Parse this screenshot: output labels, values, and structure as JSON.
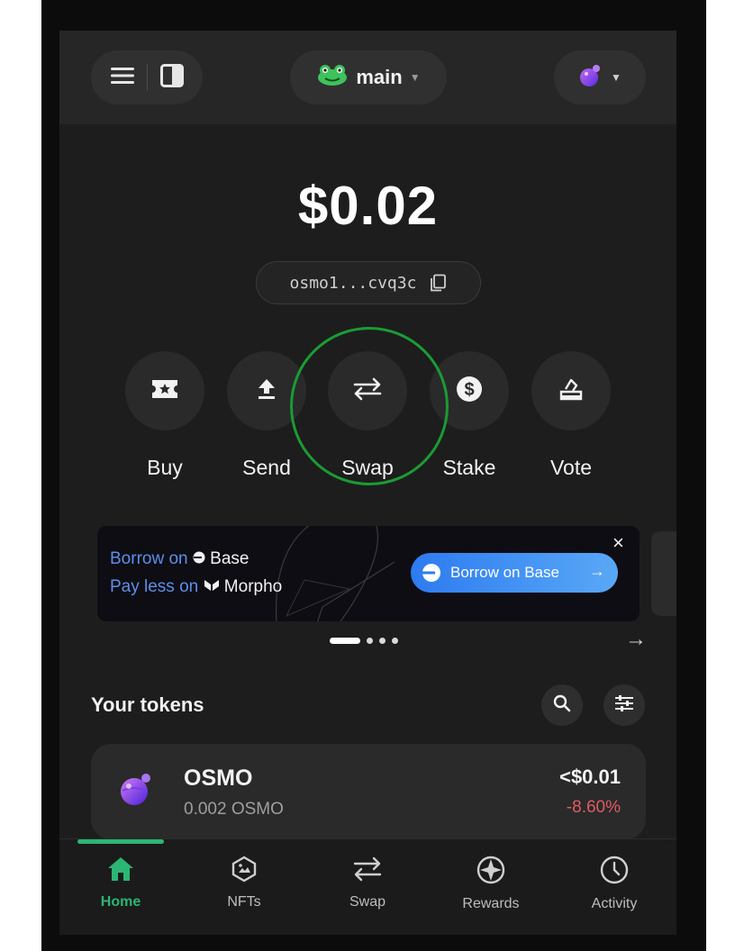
{
  "header": {
    "wallet_name": "main"
  },
  "balance": "$0.02",
  "address": "osmo1...cvq3c",
  "actions": [
    {
      "label": "Buy",
      "icon": "ticket-icon"
    },
    {
      "label": "Send",
      "icon": "upload-icon"
    },
    {
      "label": "Swap",
      "icon": "swap-arrows-icon"
    },
    {
      "label": "Stake",
      "icon": "dollar-coin-icon"
    },
    {
      "label": "Vote",
      "icon": "ballot-icon"
    }
  ],
  "banner": {
    "line1_prefix": "Borrow on",
    "line1_brand": "Base",
    "line2_prefix": "Pay less on",
    "line2_brand": "Morpho",
    "button_label": "Borrow on Base",
    "close": "×"
  },
  "carousel": {
    "next_arrow": "→"
  },
  "tokens_section": {
    "title": "Your tokens"
  },
  "tokens": [
    {
      "symbol": "OSMO",
      "amount": "0.002 OSMO",
      "value": "<$0.01",
      "change": "-8.60%"
    }
  ],
  "bottom_nav": [
    {
      "label": "Home",
      "active": true
    },
    {
      "label": "NFTs",
      "active": false
    },
    {
      "label": "Swap",
      "active": false
    },
    {
      "label": "Rewards",
      "active": false
    },
    {
      "label": "Activity",
      "active": false
    }
  ],
  "colors": {
    "accent_green": "#2bb673",
    "highlight_ring": "#1a9b33",
    "negative_red": "#e05a63",
    "banner_blue": "#5b8fe8"
  }
}
